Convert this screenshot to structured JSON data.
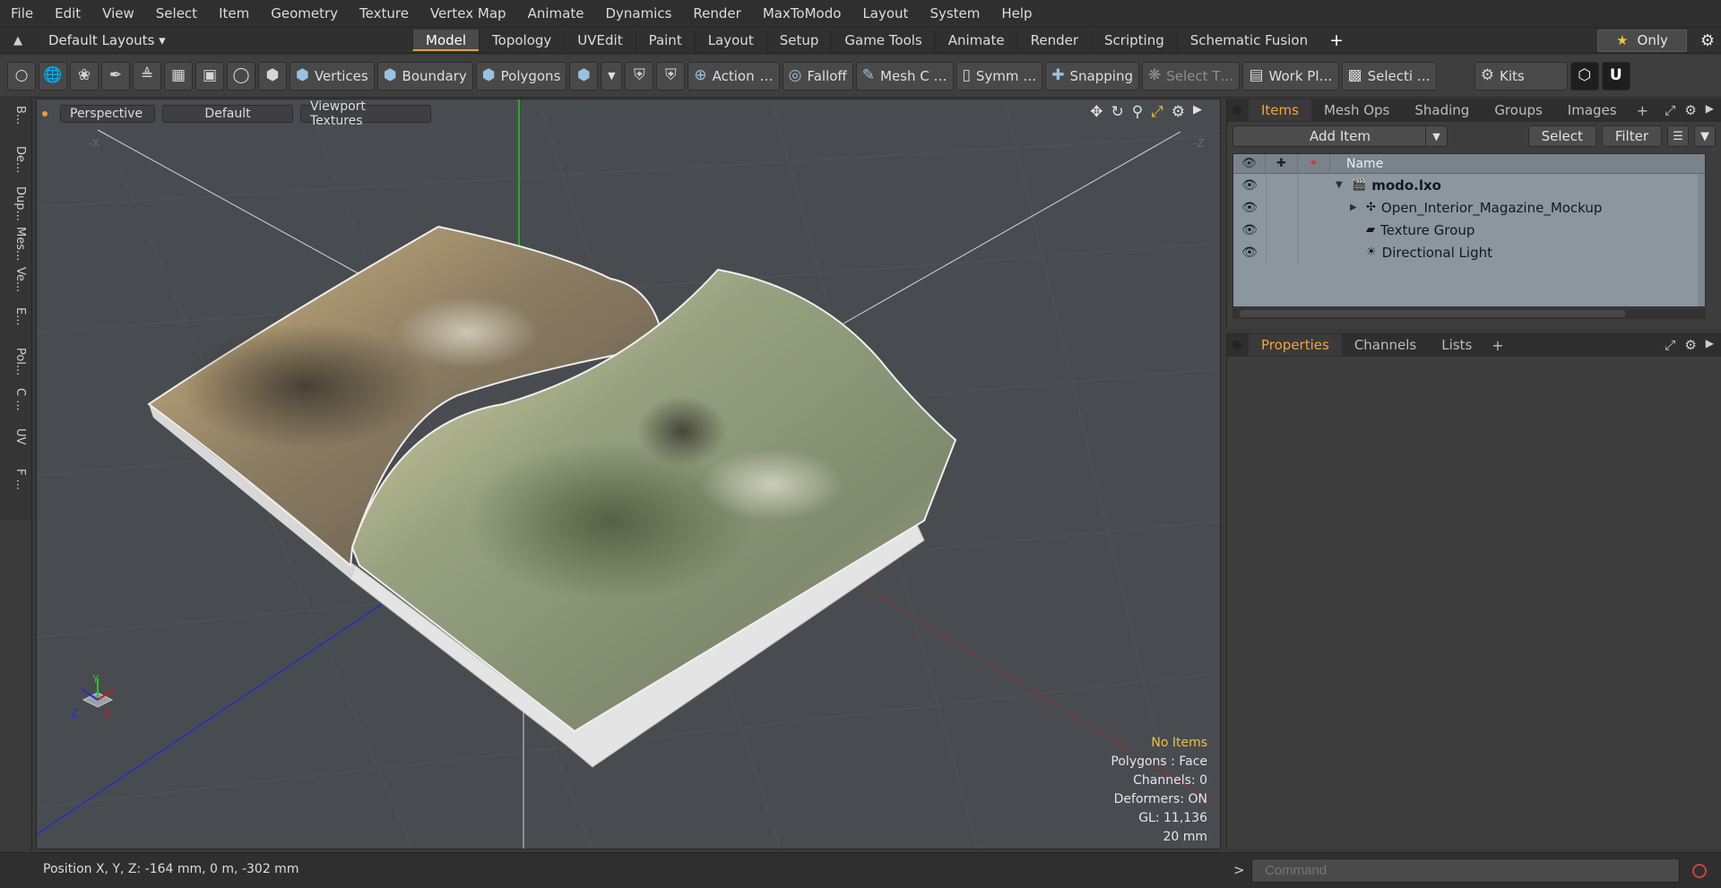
{
  "menubar": [
    "File",
    "Edit",
    "View",
    "Select",
    "Item",
    "Geometry",
    "Texture",
    "Vertex Map",
    "Animate",
    "Dynamics",
    "Render",
    "MaxToModo",
    "Layout",
    "System",
    "Help"
  ],
  "layout_bar": {
    "layouts_label": "Default Layouts ▾",
    "tabs": [
      "Model",
      "Topology",
      "UVEdit",
      "Paint",
      "Layout",
      "Setup",
      "Game Tools",
      "Animate",
      "Render",
      "Scripting",
      "Schematic Fusion"
    ],
    "active_tab": "Model",
    "plus": "+",
    "only_label": "Only"
  },
  "toolbar": {
    "vertices": "Vertices",
    "boundary": "Boundary",
    "polygons": "Polygons",
    "action": "Action",
    "action_more": "…",
    "falloff": "Falloff",
    "mesh": "Mesh C …",
    "symmetry": "Symm …",
    "snapping": "Snapping",
    "select_t": "Select T…",
    "work_plane": "Work Pl…",
    "selection": "Selecti …",
    "kits": "Kits"
  },
  "left_tabs": [
    "B...",
    "De...",
    "Dup...",
    "Mes...",
    "Ve...",
    "E...",
    "Pol...",
    "C ...",
    "UV",
    "F ..."
  ],
  "viewport": {
    "perspective": "Perspective",
    "default": "Default",
    "textures": "Viewport Textures",
    "axis_x_label": "-X",
    "axis_z_label": "-Z",
    "info": {
      "no_items": "No Items",
      "polygons": "Polygons : Face",
      "channels": "Channels: 0",
      "deformers": "Deformers: ON",
      "gl": "GL: 11,136",
      "scale": "20 mm"
    },
    "gizmo": {
      "y": "Y",
      "x": "X",
      "z": "Z"
    }
  },
  "items_panel": {
    "tabs": [
      "Items",
      "Mesh Ops",
      "Shading",
      "Groups",
      "Images"
    ],
    "active": "Items",
    "plus": "+",
    "add_item": "Add Item",
    "select": "Select",
    "filter": "Filter",
    "name_header": "Name",
    "tree": [
      {
        "label": "modo.lxo",
        "level": 0,
        "expander": "▼",
        "icon": "scene-icon"
      },
      {
        "label": "Open_Interior_Magazine_Mockup",
        "level": 1,
        "expander": "▶",
        "icon": "mesh-item-icon"
      },
      {
        "label": "Texture Group",
        "level": 1,
        "expander": "",
        "icon": "texture-group-icon"
      },
      {
        "label": "Directional Light",
        "level": 1,
        "expander": "",
        "icon": "light-icon"
      }
    ]
  },
  "props_panel": {
    "tabs": [
      "Properties",
      "Channels",
      "Lists"
    ],
    "active": "Properties",
    "plus": "+"
  },
  "statusbar": {
    "position": "Position X, Y, Z:   -164 mm, 0 m, -302 mm",
    "prompt": ">",
    "command_placeholder": "Command"
  },
  "colors": {
    "accent": "#f0a63a",
    "viewport_bg": "#484b4f",
    "tree_bg": "#8c969f",
    "axis_x": "#c02020",
    "axis_y": "#22c822",
    "axis_z": "#2030c8"
  }
}
